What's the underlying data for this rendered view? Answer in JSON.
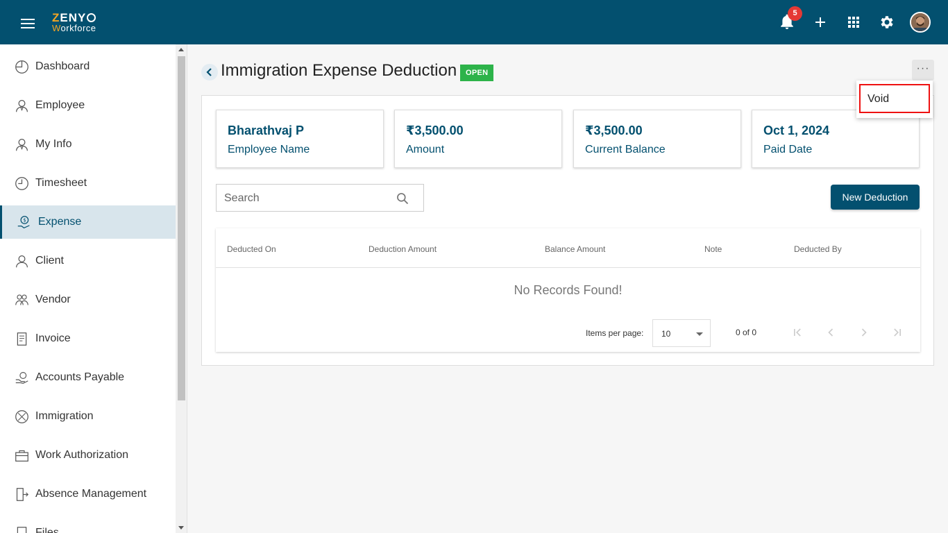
{
  "header": {
    "logo_top": "ZENY",
    "logo_bottom": "Workforce",
    "notification_count": "5",
    "icons": [
      "menu-icon",
      "bell-icon",
      "plus-icon",
      "apps-grid-icon",
      "gear-icon"
    ]
  },
  "sidebar": {
    "items": [
      {
        "label": "Dashboard",
        "icon": "dashboard-icon"
      },
      {
        "label": "Employee",
        "icon": "employee-icon"
      },
      {
        "label": "My Info",
        "icon": "my-info-icon"
      },
      {
        "label": "Timesheet",
        "icon": "clock-icon"
      },
      {
        "label": "Expense",
        "icon": "expense-icon",
        "active": true
      },
      {
        "label": "Client",
        "icon": "person-icon"
      },
      {
        "label": "Vendor",
        "icon": "vendor-icon"
      },
      {
        "label": "Invoice",
        "icon": "invoice-icon"
      },
      {
        "label": "Accounts Payable",
        "icon": "accounts-payable-icon"
      },
      {
        "label": "Immigration",
        "icon": "globe-icon"
      },
      {
        "label": "Work Authorization",
        "icon": "briefcase-icon"
      },
      {
        "label": "Absence Management",
        "icon": "door-exit-icon"
      },
      {
        "label": "Files",
        "icon": "file-icon"
      }
    ]
  },
  "page": {
    "title": "Immigration Expense Deduction",
    "status": "OPEN",
    "more_label": "···",
    "menu": {
      "void_label": "Void"
    }
  },
  "summary": {
    "cards": [
      {
        "value": "Bharathvaj P",
        "caption": "Employee Name"
      },
      {
        "value": "₹3,500.00",
        "caption": "Amount"
      },
      {
        "value": "₹3,500.00",
        "caption": "Current Balance"
      },
      {
        "value": "Oct 1, 2024",
        "caption": "Paid Date"
      }
    ]
  },
  "toolbar": {
    "search_placeholder": "Search",
    "new_button": "New Deduction"
  },
  "table": {
    "columns": [
      "Deducted On",
      "Deduction Amount",
      "Balance Amount",
      "Note",
      "Deducted By"
    ],
    "empty_message": "No Records Found!",
    "paginator": {
      "items_per_page_label": "Items per page:",
      "items_per_page": "10",
      "range": "0 of 0"
    }
  },
  "colors": {
    "primary": "#03506f",
    "status_open": "#2db34a",
    "badge": "#e53935",
    "logo_accent": "#f5a623"
  }
}
